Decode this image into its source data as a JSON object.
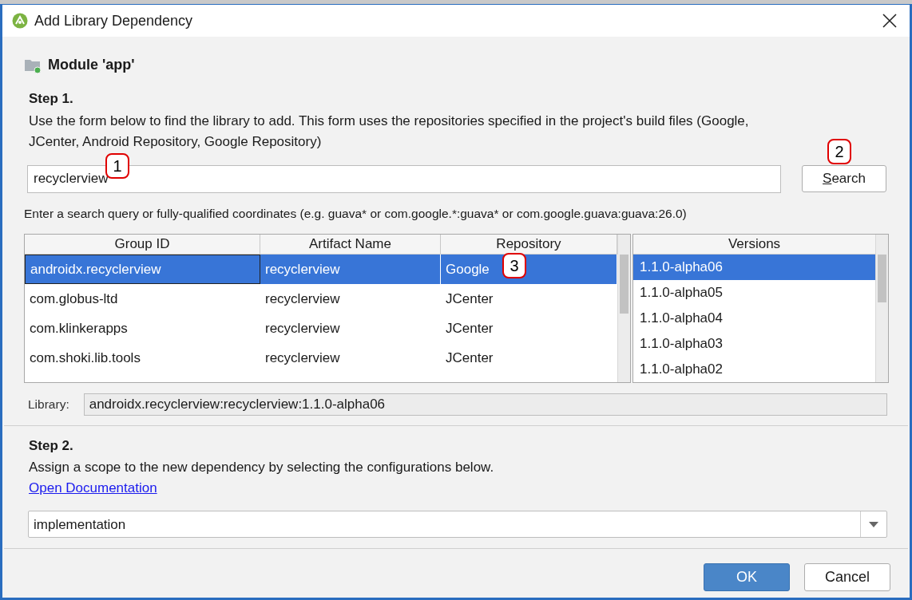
{
  "window": {
    "title": "Add Library Dependency"
  },
  "module": {
    "label": "Module 'app'"
  },
  "step1": {
    "heading": "Step 1.",
    "description": "Use the form below to find the library to add. This form uses the repositories specified in the project's build files (Google, JCenter, Android Repository, Google Repository)"
  },
  "search": {
    "value": "recyclerview",
    "button": "Search",
    "hint": "Enter a search query or fully-qualified coordinates (e.g. guava* or com.google.*:guava* or com.google.guava:guava:26.0)"
  },
  "table": {
    "columns": [
      "Group ID",
      "Artifact Name",
      "Repository"
    ],
    "rows": [
      {
        "cells": [
          "androidx.recyclerview",
          "recyclerview",
          "Google"
        ],
        "selected": true
      },
      {
        "cells": [
          "com.globus-ltd",
          "recyclerview",
          "JCenter"
        ],
        "selected": false
      },
      {
        "cells": [
          "com.klinkerapps",
          "recyclerview",
          "JCenter"
        ],
        "selected": false
      },
      {
        "cells": [
          "com.shoki.lib.tools",
          "recyclerview",
          "JCenter"
        ],
        "selected": false
      }
    ]
  },
  "versions": {
    "heading": "Versions",
    "items": [
      {
        "label": "1.1.0-alpha06",
        "selected": true
      },
      {
        "label": "1.1.0-alpha05",
        "selected": false
      },
      {
        "label": "1.1.0-alpha04",
        "selected": false
      },
      {
        "label": "1.1.0-alpha03",
        "selected": false
      },
      {
        "label": "1.1.0-alpha02",
        "selected": false
      }
    ]
  },
  "library": {
    "label": "Library:",
    "value": "androidx.recyclerview:recyclerview:1.1.0-alpha06"
  },
  "step2": {
    "heading": "Step 2.",
    "description": "Assign a scope to the new dependency by selecting the configurations below.",
    "link": "Open Documentation"
  },
  "scope": {
    "value": "implementation"
  },
  "buttons": [
    {
      "label": "OK",
      "primary": true
    },
    {
      "label": "Cancel",
      "primary": false
    }
  ],
  "annotations": [
    "1",
    "2",
    "3"
  ]
}
